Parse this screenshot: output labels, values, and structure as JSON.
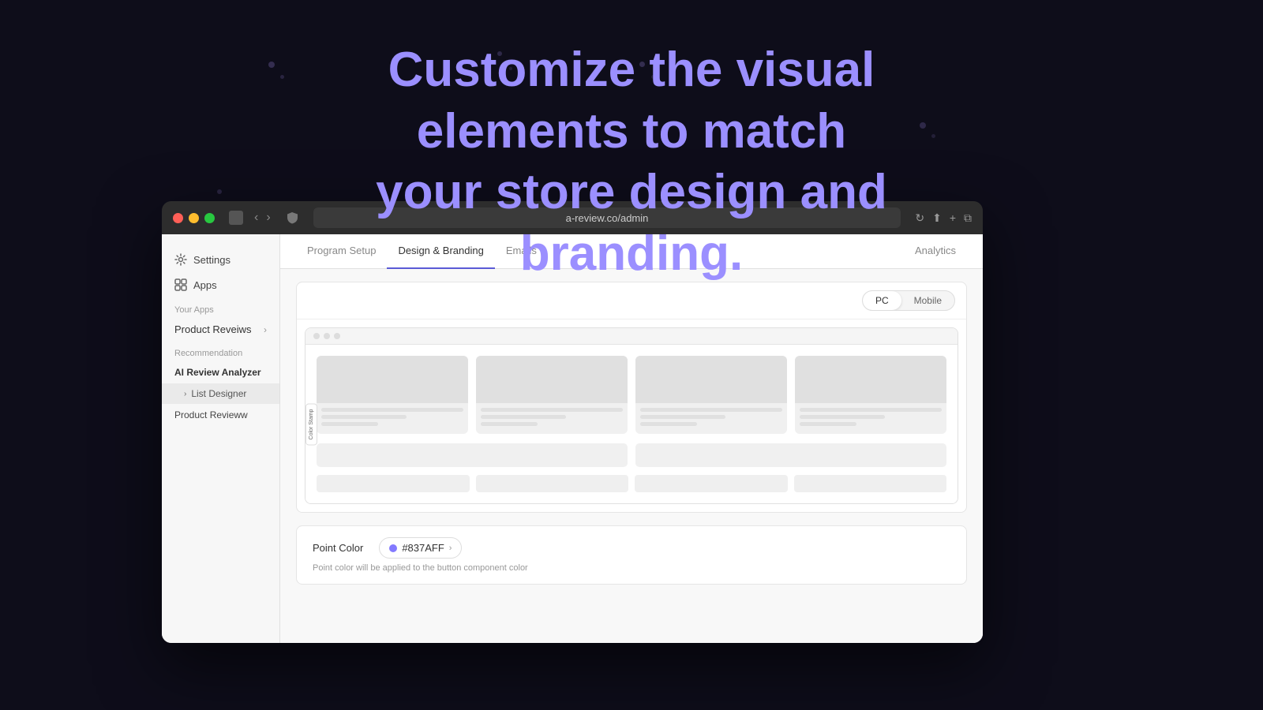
{
  "hero": {
    "line1": "Customize the visual elements to match",
    "line2": "your store design and branding."
  },
  "browser": {
    "url": "a-review.co/admin",
    "traffic_lights": [
      "red",
      "yellow",
      "green"
    ]
  },
  "sidebar": {
    "settings_label": "Settings",
    "apps_label": "Apps",
    "your_apps_label": "Your Apps",
    "product_reviews_label": "Product Reveiws",
    "recommendation_label": "Recommendation",
    "ai_review_analyzer_label": "AI Review Analyzer",
    "list_designer_label": "List Designer",
    "product_review_label": "Product Revieww"
  },
  "tabs": {
    "program_setup": "Program Setup",
    "design_branding": "Design & Branding",
    "emails": "Emails",
    "analytics": "Analytics"
  },
  "preview": {
    "pc_label": "PC",
    "mobile_label": "Mobile"
  },
  "point_color": {
    "label": "Point Color",
    "value": "#837AFF",
    "description": "Point color will be applied to the button component color"
  }
}
